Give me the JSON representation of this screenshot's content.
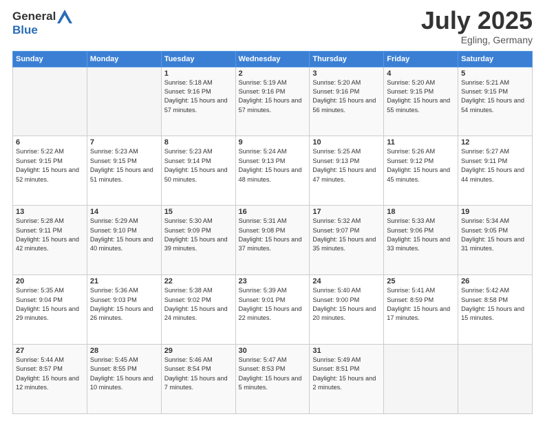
{
  "header": {
    "logo": {
      "general": "General",
      "blue": "Blue"
    },
    "title": "July 2025",
    "location": "Egling, Germany"
  },
  "weekdays": [
    "Sunday",
    "Monday",
    "Tuesday",
    "Wednesday",
    "Thursday",
    "Friday",
    "Saturday"
  ],
  "weeks": [
    [
      {
        "day": "",
        "sunrise": "",
        "sunset": "",
        "daylight": ""
      },
      {
        "day": "",
        "sunrise": "",
        "sunset": "",
        "daylight": ""
      },
      {
        "day": "1",
        "sunrise": "Sunrise: 5:18 AM",
        "sunset": "Sunset: 9:16 PM",
        "daylight": "Daylight: 15 hours and 57 minutes."
      },
      {
        "day": "2",
        "sunrise": "Sunrise: 5:19 AM",
        "sunset": "Sunset: 9:16 PM",
        "daylight": "Daylight: 15 hours and 57 minutes."
      },
      {
        "day": "3",
        "sunrise": "Sunrise: 5:20 AM",
        "sunset": "Sunset: 9:16 PM",
        "daylight": "Daylight: 15 hours and 56 minutes."
      },
      {
        "day": "4",
        "sunrise": "Sunrise: 5:20 AM",
        "sunset": "Sunset: 9:15 PM",
        "daylight": "Daylight: 15 hours and 55 minutes."
      },
      {
        "day": "5",
        "sunrise": "Sunrise: 5:21 AM",
        "sunset": "Sunset: 9:15 PM",
        "daylight": "Daylight: 15 hours and 54 minutes."
      }
    ],
    [
      {
        "day": "6",
        "sunrise": "Sunrise: 5:22 AM",
        "sunset": "Sunset: 9:15 PM",
        "daylight": "Daylight: 15 hours and 52 minutes."
      },
      {
        "day": "7",
        "sunrise": "Sunrise: 5:23 AM",
        "sunset": "Sunset: 9:15 PM",
        "daylight": "Daylight: 15 hours and 51 minutes."
      },
      {
        "day": "8",
        "sunrise": "Sunrise: 5:23 AM",
        "sunset": "Sunset: 9:14 PM",
        "daylight": "Daylight: 15 hours and 50 minutes."
      },
      {
        "day": "9",
        "sunrise": "Sunrise: 5:24 AM",
        "sunset": "Sunset: 9:13 PM",
        "daylight": "Daylight: 15 hours and 48 minutes."
      },
      {
        "day": "10",
        "sunrise": "Sunrise: 5:25 AM",
        "sunset": "Sunset: 9:13 PM",
        "daylight": "Daylight: 15 hours and 47 minutes."
      },
      {
        "day": "11",
        "sunrise": "Sunrise: 5:26 AM",
        "sunset": "Sunset: 9:12 PM",
        "daylight": "Daylight: 15 hours and 45 minutes."
      },
      {
        "day": "12",
        "sunrise": "Sunrise: 5:27 AM",
        "sunset": "Sunset: 9:11 PM",
        "daylight": "Daylight: 15 hours and 44 minutes."
      }
    ],
    [
      {
        "day": "13",
        "sunrise": "Sunrise: 5:28 AM",
        "sunset": "Sunset: 9:11 PM",
        "daylight": "Daylight: 15 hours and 42 minutes."
      },
      {
        "day": "14",
        "sunrise": "Sunrise: 5:29 AM",
        "sunset": "Sunset: 9:10 PM",
        "daylight": "Daylight: 15 hours and 40 minutes."
      },
      {
        "day": "15",
        "sunrise": "Sunrise: 5:30 AM",
        "sunset": "Sunset: 9:09 PM",
        "daylight": "Daylight: 15 hours and 39 minutes."
      },
      {
        "day": "16",
        "sunrise": "Sunrise: 5:31 AM",
        "sunset": "Sunset: 9:08 PM",
        "daylight": "Daylight: 15 hours and 37 minutes."
      },
      {
        "day": "17",
        "sunrise": "Sunrise: 5:32 AM",
        "sunset": "Sunset: 9:07 PM",
        "daylight": "Daylight: 15 hours and 35 minutes."
      },
      {
        "day": "18",
        "sunrise": "Sunrise: 5:33 AM",
        "sunset": "Sunset: 9:06 PM",
        "daylight": "Daylight: 15 hours and 33 minutes."
      },
      {
        "day": "19",
        "sunrise": "Sunrise: 5:34 AM",
        "sunset": "Sunset: 9:05 PM",
        "daylight": "Daylight: 15 hours and 31 minutes."
      }
    ],
    [
      {
        "day": "20",
        "sunrise": "Sunrise: 5:35 AM",
        "sunset": "Sunset: 9:04 PM",
        "daylight": "Daylight: 15 hours and 29 minutes."
      },
      {
        "day": "21",
        "sunrise": "Sunrise: 5:36 AM",
        "sunset": "Sunset: 9:03 PM",
        "daylight": "Daylight: 15 hours and 26 minutes."
      },
      {
        "day": "22",
        "sunrise": "Sunrise: 5:38 AM",
        "sunset": "Sunset: 9:02 PM",
        "daylight": "Daylight: 15 hours and 24 minutes."
      },
      {
        "day": "23",
        "sunrise": "Sunrise: 5:39 AM",
        "sunset": "Sunset: 9:01 PM",
        "daylight": "Daylight: 15 hours and 22 minutes."
      },
      {
        "day": "24",
        "sunrise": "Sunrise: 5:40 AM",
        "sunset": "Sunset: 9:00 PM",
        "daylight": "Daylight: 15 hours and 20 minutes."
      },
      {
        "day": "25",
        "sunrise": "Sunrise: 5:41 AM",
        "sunset": "Sunset: 8:59 PM",
        "daylight": "Daylight: 15 hours and 17 minutes."
      },
      {
        "day": "26",
        "sunrise": "Sunrise: 5:42 AM",
        "sunset": "Sunset: 8:58 PM",
        "daylight": "Daylight: 15 hours and 15 minutes."
      }
    ],
    [
      {
        "day": "27",
        "sunrise": "Sunrise: 5:44 AM",
        "sunset": "Sunset: 8:57 PM",
        "daylight": "Daylight: 15 hours and 12 minutes."
      },
      {
        "day": "28",
        "sunrise": "Sunrise: 5:45 AM",
        "sunset": "Sunset: 8:55 PM",
        "daylight": "Daylight: 15 hours and 10 minutes."
      },
      {
        "day": "29",
        "sunrise": "Sunrise: 5:46 AM",
        "sunset": "Sunset: 8:54 PM",
        "daylight": "Daylight: 15 hours and 7 minutes."
      },
      {
        "day": "30",
        "sunrise": "Sunrise: 5:47 AM",
        "sunset": "Sunset: 8:53 PM",
        "daylight": "Daylight: 15 hours and 5 minutes."
      },
      {
        "day": "31",
        "sunrise": "Sunrise: 5:49 AM",
        "sunset": "Sunset: 8:51 PM",
        "daylight": "Daylight: 15 hours and 2 minutes."
      },
      {
        "day": "",
        "sunrise": "",
        "sunset": "",
        "daylight": ""
      },
      {
        "day": "",
        "sunrise": "",
        "sunset": "",
        "daylight": ""
      }
    ]
  ]
}
